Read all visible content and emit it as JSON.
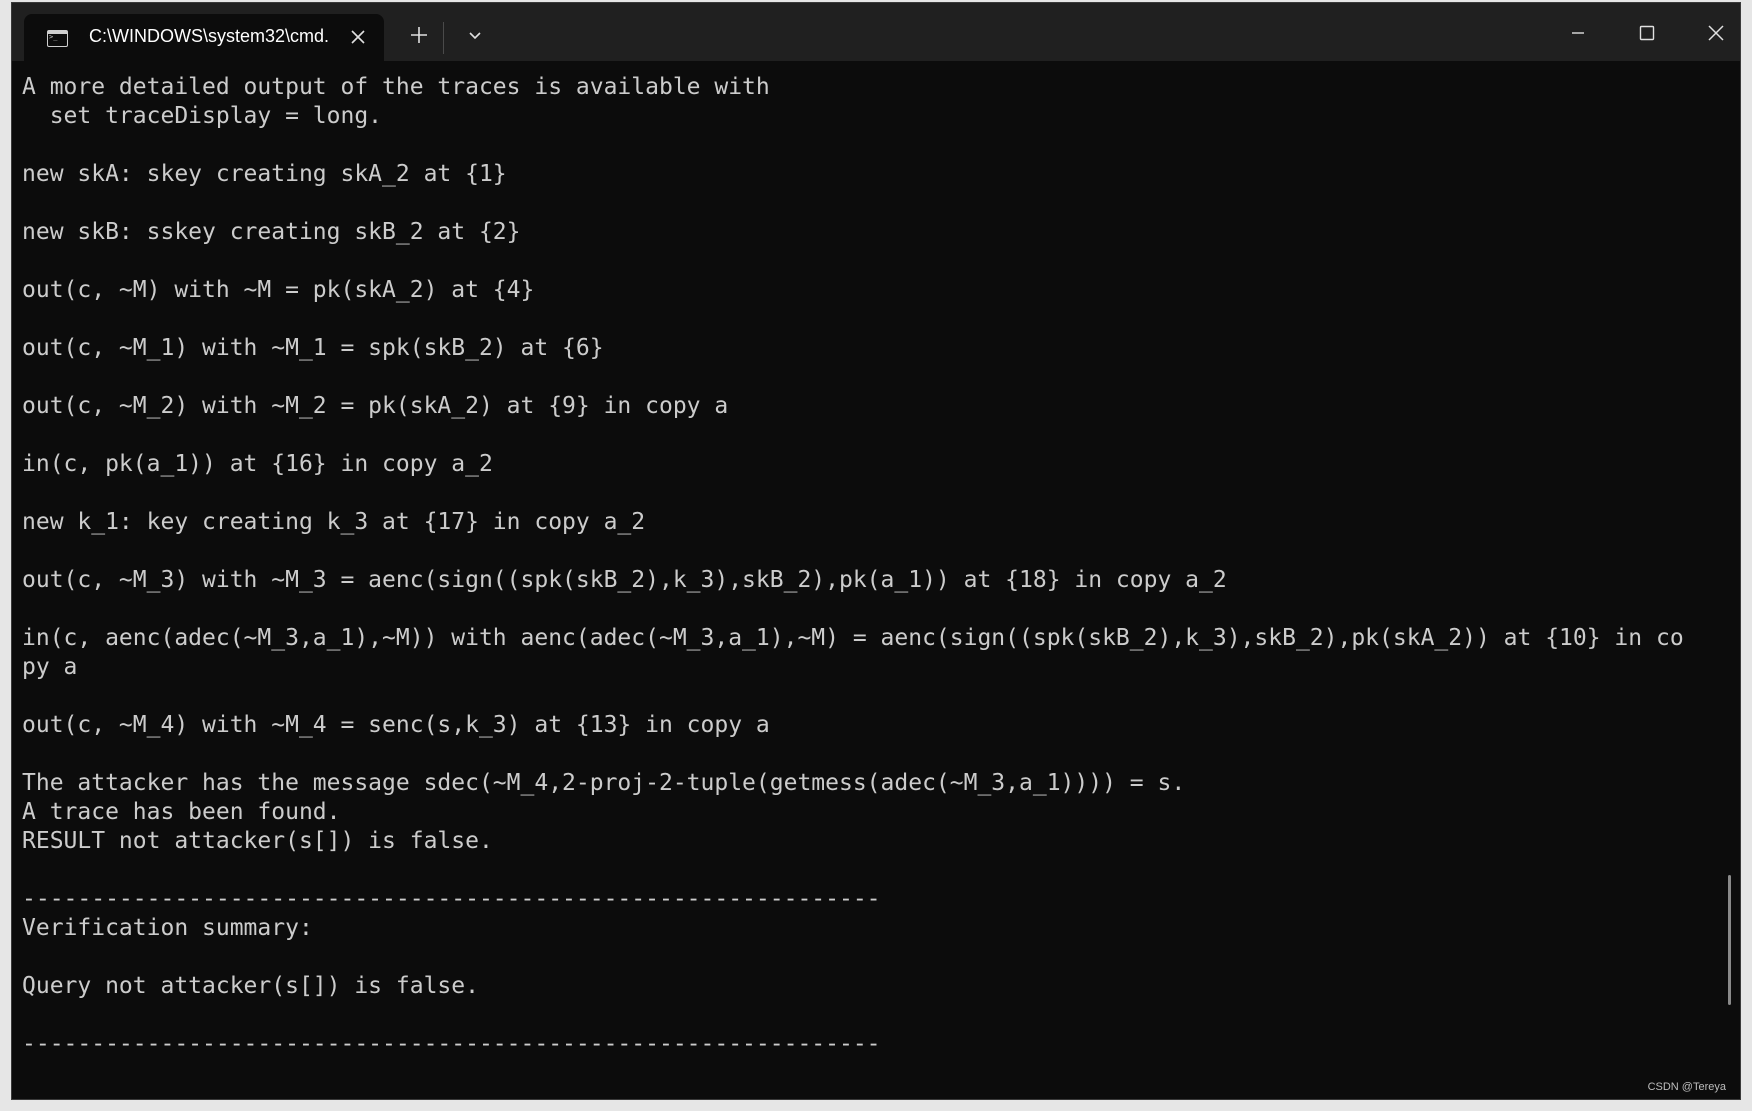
{
  "window": {
    "tab_title": "C:\\WINDOWS\\system32\\cmd.",
    "icons": {
      "tab": "terminal-icon",
      "close_tab": "close-icon",
      "new_tab": "plus-icon",
      "dropdown": "chevron-down-icon",
      "minimize": "minimize-icon",
      "maximize": "maximize-icon",
      "close_window": "close-icon"
    }
  },
  "terminal": {
    "lines": [
      "A more detailed output of the traces is available with",
      "  set traceDisplay = long.",
      "",
      "new skA: skey creating skA_2 at {1}",
      "",
      "new skB: sskey creating skB_2 at {2}",
      "",
      "out(c, ~M) with ~M = pk(skA_2) at {4}",
      "",
      "out(c, ~M_1) with ~M_1 = spk(skB_2) at {6}",
      "",
      "out(c, ~M_2) with ~M_2 = pk(skA_2) at {9} in copy a",
      "",
      "in(c, pk(a_1)) at {16} in copy a_2",
      "",
      "new k_1: key creating k_3 at {17} in copy a_2",
      "",
      "out(c, ~M_3) with ~M_3 = aenc(sign((spk(skB_2),k_3),skB_2),pk(a_1)) at {18} in copy a_2",
      "",
      "in(c, aenc(adec(~M_3,a_1),~M)) with aenc(adec(~M_3,a_1),~M) = aenc(sign((spk(skB_2),k_3),skB_2),pk(skA_2)) at {10} in co",
      "py a",
      "",
      "out(c, ~M_4) with ~M_4 = senc(s,k_3) at {13} in copy a",
      "",
      "The attacker has the message sdec(~M_4,2-proj-2-tuple(getmess(adec(~M_3,a_1)))) = s.",
      "A trace has been found.",
      "RESULT not attacker(s[]) is false.",
      "",
      "--------------------------------------------------------------",
      "Verification summary:",
      "",
      "Query not attacker(s[]) is false.",
      "",
      "--------------------------------------------------------------"
    ]
  },
  "watermark": "CSDN @Tereya",
  "colors": {
    "background": "#0c0c0c",
    "titlebar": "#202020",
    "text": "#cccccc"
  }
}
